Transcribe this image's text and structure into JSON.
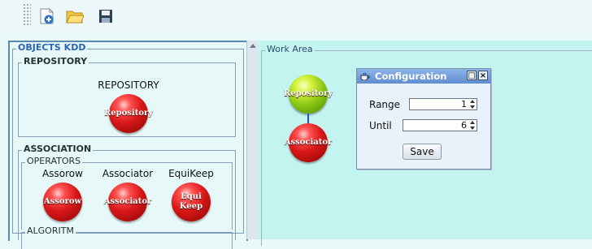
{
  "toolbar": {
    "buttons": [
      {
        "name": "new-file-button",
        "icon": "new-file-icon"
      },
      {
        "name": "open-folder-button",
        "icon": "folder-icon"
      },
      {
        "name": "save-disk-button",
        "icon": "floppy-disk-icon"
      }
    ]
  },
  "objects_panel": {
    "title": "OBJECTS KDD",
    "repository_group": {
      "title": "REPOSITORY",
      "items": [
        {
          "label": "REPOSITORY",
          "ball_text": "Repository"
        }
      ]
    },
    "association_group": {
      "title": "ASSOCIATION",
      "operators_group": {
        "title": "OPERATORS",
        "items": [
          {
            "label": "Assorow",
            "ball_text": "Assorow"
          },
          {
            "label": "Associator",
            "ball_text": "Associator"
          },
          {
            "label": "EquiKeep",
            "ball_text": "Equi Keep"
          }
        ]
      },
      "algoritm_group": {
        "title": "ALGORITM"
      }
    }
  },
  "work_area": {
    "title": "Work Area",
    "nodes": [
      {
        "ball_text": "Repository",
        "color": "green"
      },
      {
        "ball_text": "Associator",
        "color": "red"
      }
    ]
  },
  "config_dialog": {
    "title": "Configuration",
    "range_label": "Range",
    "range_value": "1",
    "until_label": "Until",
    "until_value": "6",
    "save_label": "Save"
  },
  "colors": {
    "accent_blue": "#2a63b8",
    "panel_border": "#5a88b0",
    "work_area_bg": "#c4f4f0",
    "dialog_title_bg": "#6f9bd8"
  }
}
